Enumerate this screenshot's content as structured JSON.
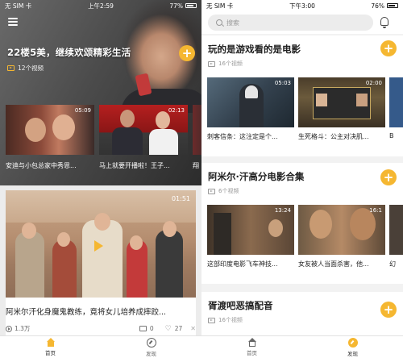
{
  "left_phone": {
    "status": {
      "carrier": "无 SIM 卡",
      "time": "上午2:59",
      "battery": "77%",
      "battery_level": 0.77
    },
    "hero": {
      "title": "22楼5美，继续欢颂精彩生活",
      "count": "12个视频",
      "items": [
        {
          "duration": "05:09",
          "caption": "安迪与小包总家中秀恩..."
        },
        {
          "duration": "02:13",
          "caption": "马上就要开播啦！王子..."
        },
        {
          "duration": "",
          "caption": "翔"
        }
      ]
    },
    "card": {
      "duration": "01:51",
      "title": "阿米尔汗化身魔鬼教练，竟将女儿培养成摔跤...",
      "views": "1.3万",
      "comments": "0",
      "likes": "27"
    },
    "tabbar": {
      "home": "首页",
      "discover": "发现"
    }
  },
  "right_phone": {
    "status": {
      "carrier": "无 SIM 卡",
      "time": "下午3:00",
      "battery": "76%",
      "battery_level": 0.76
    },
    "search": {
      "placeholder": "搜索"
    },
    "sections": [
      {
        "title": "玩的是游戏看的是电影",
        "count": "16个视频",
        "items": [
          {
            "duration": "05:03",
            "caption": "刺客信条：这注定是个..."
          },
          {
            "duration": "02:00",
            "caption": "生死格斗：公主对决肌..."
          }
        ],
        "peek_caption": "B"
      },
      {
        "title": "阿米尔·汗高分电影合集",
        "count": "6个视频",
        "items": [
          {
            "duration": "13:24",
            "caption": "这部印度电影飞车神技..."
          },
          {
            "duration": "16:1",
            "caption": "女友被人当面杀害，他..."
          }
        ],
        "peek_caption": "幻"
      },
      {
        "title": "胥渡吧恶搞配音",
        "count": "16个视频"
      }
    ],
    "tabbar": {
      "home": "首页",
      "discover": "发现"
    }
  },
  "colors": {
    "accent": "#f5b731"
  }
}
